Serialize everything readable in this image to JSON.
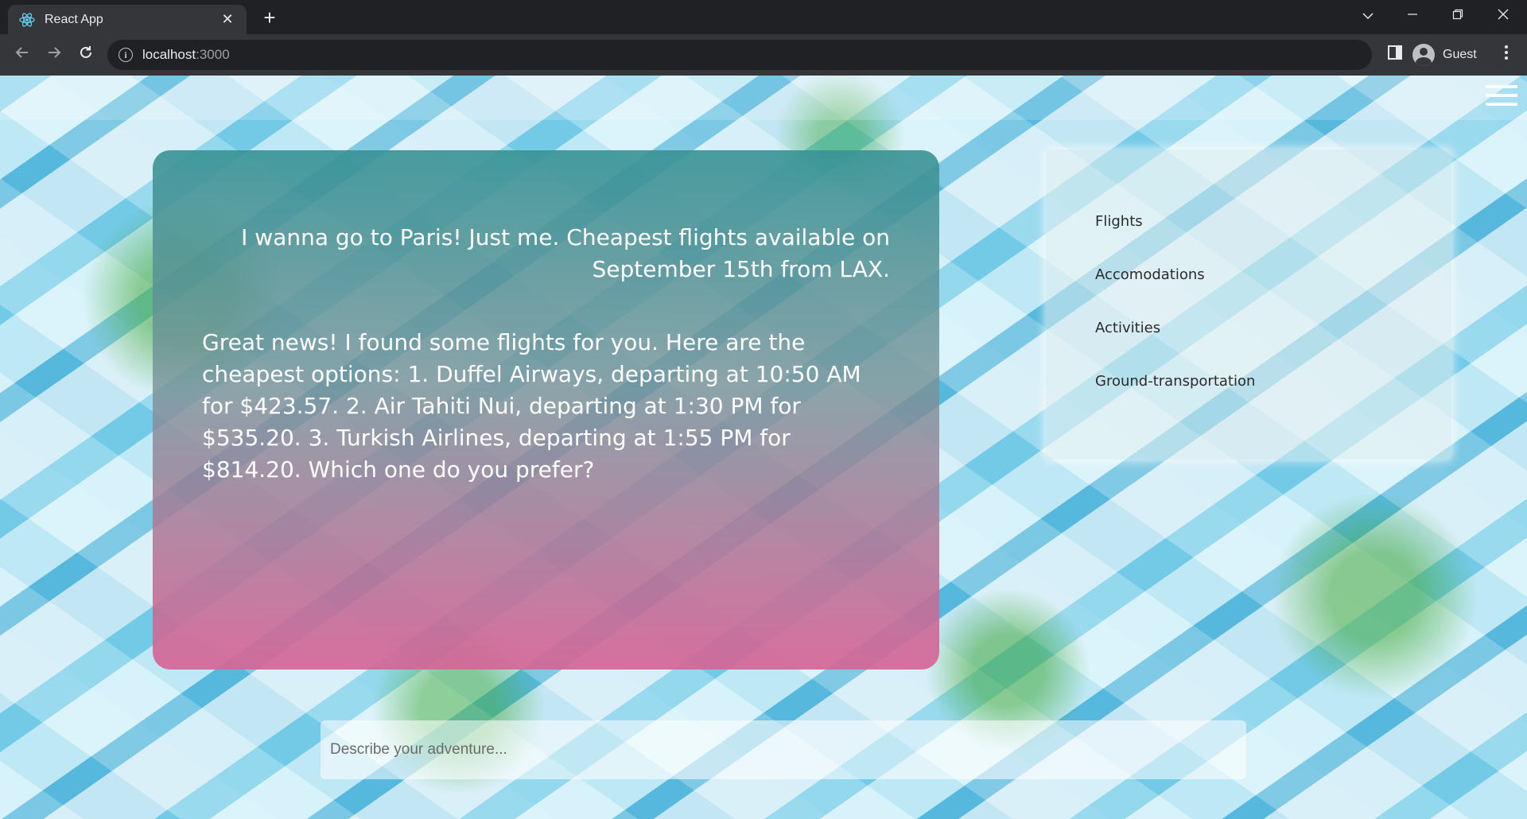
{
  "browser": {
    "tab_title": "React App",
    "tab_close": "✕",
    "new_tab": "+",
    "url_host": "localhost",
    "url_port": ":3000",
    "profile_name": "Guest",
    "icons": {
      "favicon": "react-logo-icon",
      "back": "arrow-left-icon",
      "forward": "arrow-right-icon",
      "reload": "reload-icon",
      "site_info": "info-icon",
      "side_panel": "side-panel-icon",
      "menu": "kebab-menu-icon",
      "tab_search": "chevron-down-icon",
      "minimize": "minimize-icon",
      "restore": "restore-icon",
      "close": "close-icon"
    }
  },
  "chat": {
    "user_message": "I wanna go to Paris! Just me. Cheapest flights available on September 15th from LAX.",
    "bot_message": "Great news! I found some flights for you. Here are the cheapest options: 1. Duffel Airways, departing at 10:50 AM for $423.57. 2. Air Tahiti Nui, departing at 1:30 PM for $535.20. 3. Turkish Airlines, departing at 1:55 PM for $814.20. Which one do you prefer?"
  },
  "categories": [
    {
      "label": "Flights"
    },
    {
      "label": "Accomodations"
    },
    {
      "label": "Activities"
    },
    {
      "label": "Ground-transportation"
    }
  ],
  "prompt": {
    "placeholder": "Describe your adventure...",
    "value": ""
  },
  "colors": {
    "chat_gradient_top": "#3a9496",
    "chat_gradient_bottom": "#d76496",
    "chrome_dark": "#202124",
    "chrome_toolbar": "#35363a"
  }
}
